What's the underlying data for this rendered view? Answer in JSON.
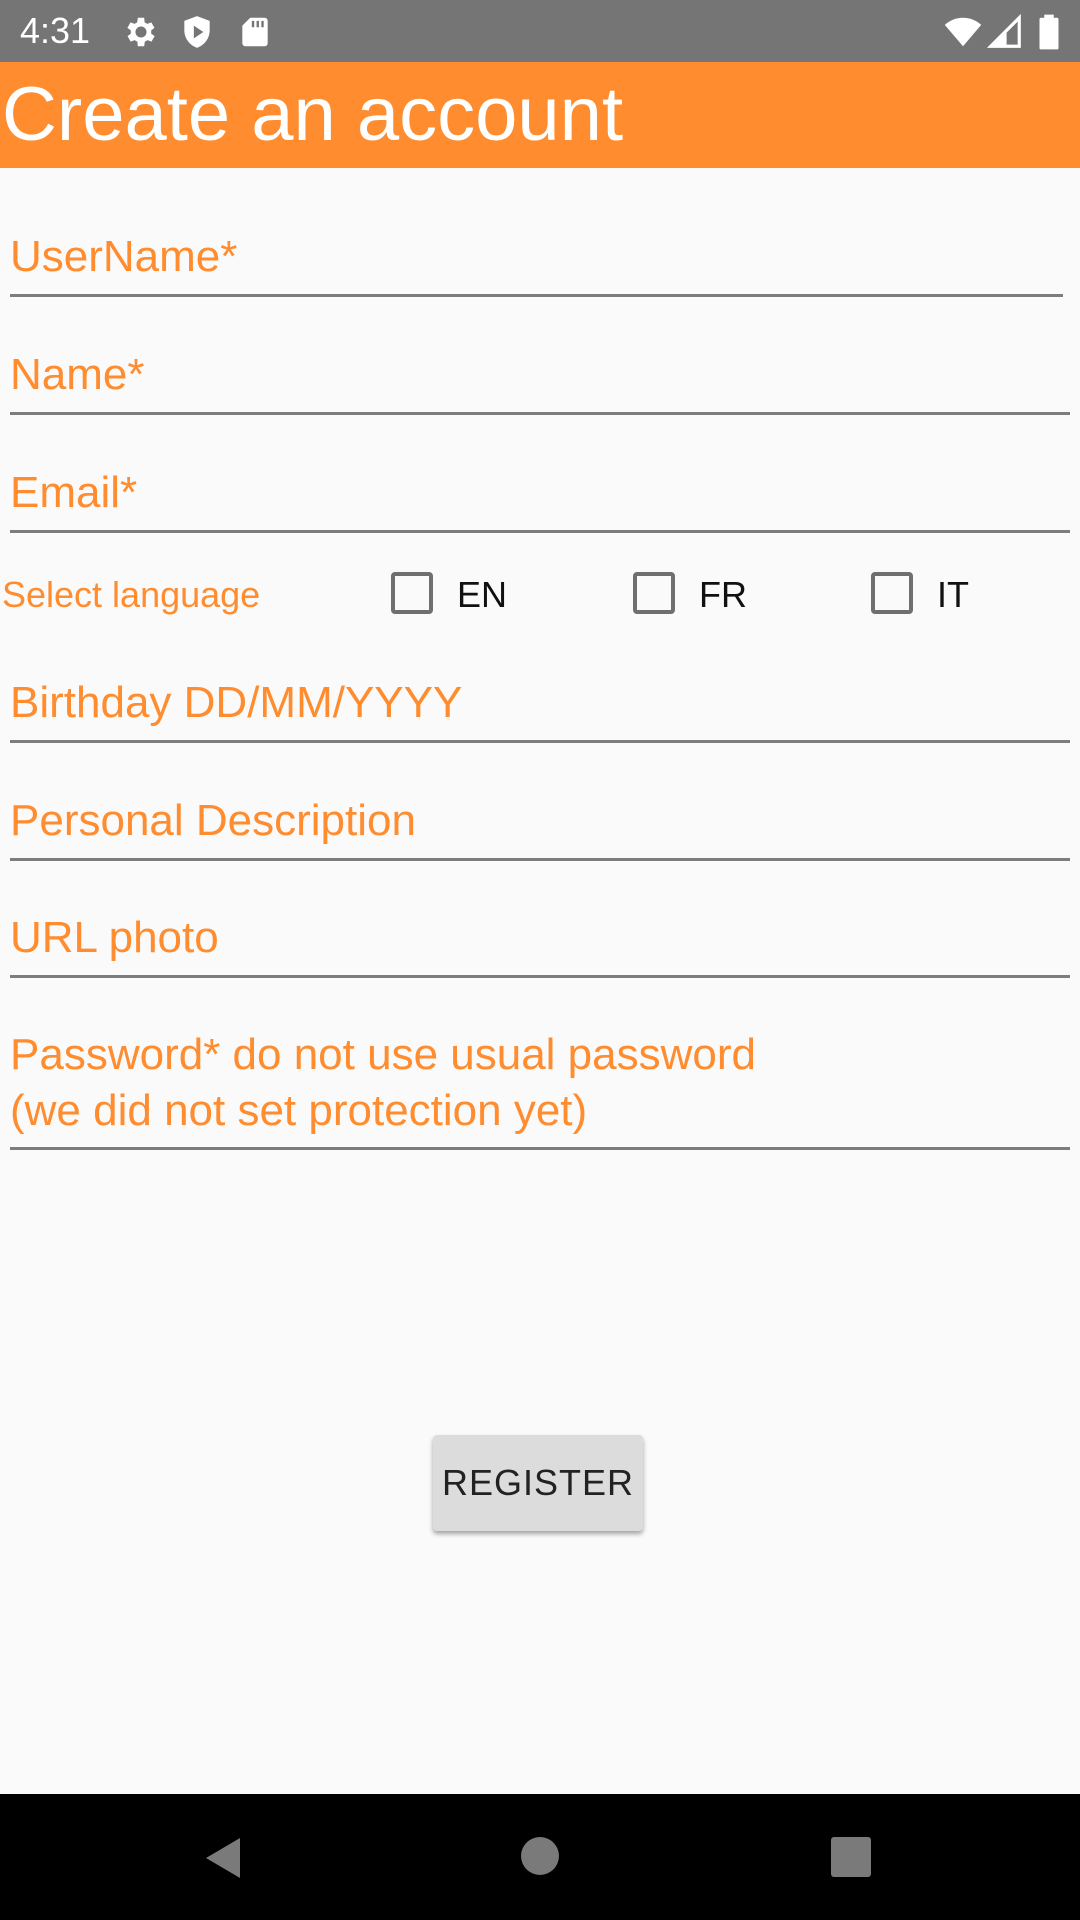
{
  "status_bar": {
    "time": "4:31",
    "icons": [
      "settings-icon",
      "shield-icon",
      "sd-card-icon",
      "wifi-icon",
      "signal-icon",
      "battery-icon"
    ]
  },
  "app_bar": {
    "title": "Create an account",
    "color": "#ff8c2e"
  },
  "form": {
    "username_placeholder": "UserName*",
    "name_placeholder": "Name*",
    "email_placeholder": "Email*",
    "language": {
      "label": "Select language",
      "options": [
        {
          "label": "EN",
          "checked": false
        },
        {
          "label": "FR",
          "checked": false
        },
        {
          "label": "IT",
          "checked": false
        }
      ]
    },
    "birthday_placeholder": "Birthday DD/MM/YYYY",
    "description_placeholder": "Personal Description",
    "photo_placeholder": "URL photo",
    "password_placeholder_line1": "Password* do not use usual password",
    "password_placeholder_line2": "(we did not set protection yet)"
  },
  "register_label": "REGISTER",
  "nav_bar": {
    "icons": [
      "back-icon",
      "home-icon",
      "recents-icon"
    ]
  }
}
